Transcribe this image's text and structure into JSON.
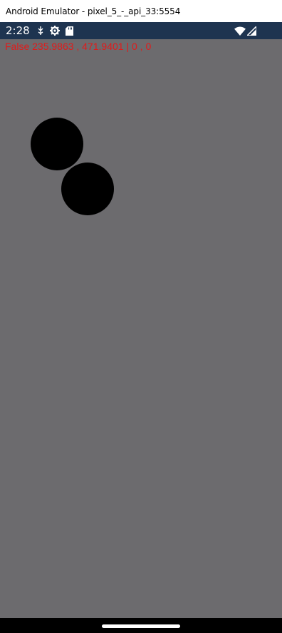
{
  "window": {
    "title": "Android Emulator - pixel_5_-_api_33:5554"
  },
  "status_bar": {
    "time": "2:28",
    "left_icons": [
      "usb-debug-icon",
      "settings-gear-icon",
      "sd-card-icon"
    ],
    "right_icons": [
      "wifi-icon",
      "cell-signal-icon"
    ],
    "background_color": "#1e3450"
  },
  "app": {
    "debug_text": "False 235.9863 , 471.9401 | 0 , 0",
    "debug_text_color": "#e21a1a",
    "background_color": "#6c6b6e",
    "circle_color": "#000000"
  },
  "nav_bar": {
    "handle": "home-handle"
  }
}
